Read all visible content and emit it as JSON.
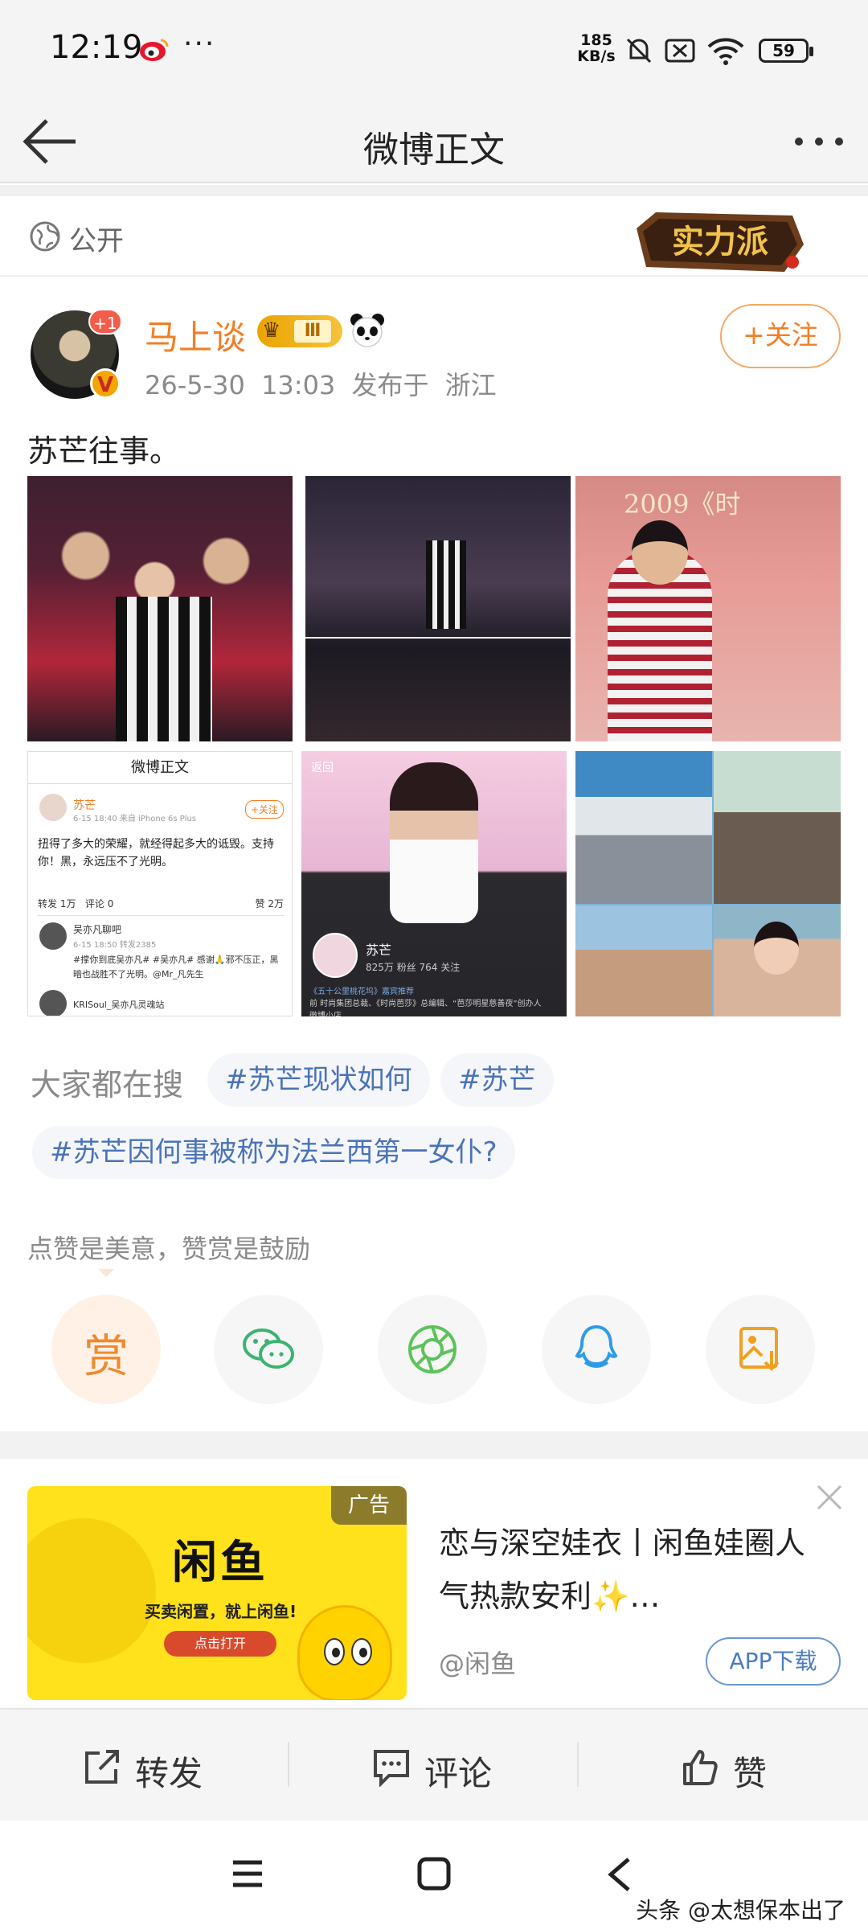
{
  "status_bar": {
    "time": "12:19",
    "more": "···",
    "network_speed_value": "185",
    "network_speed_unit": "KB/s",
    "battery": "59"
  },
  "header": {
    "title": "微博正文"
  },
  "visibility": {
    "label": "公开",
    "badge_text": "实力派"
  },
  "author": {
    "name": "马上谈",
    "notification_count": "+1",
    "level_badge": "Ⅲ",
    "verified_mark": "V",
    "timestamp": "26-5-30 13:03",
    "location": "发布于 浙江",
    "follow_label": "+关注"
  },
  "post": {
    "text": "苏芒往事。",
    "images": [
      {
        "icon": "photo-event-audience"
      },
      {
        "icon": "photo-event-collage"
      },
      {
        "icon": "photo-speech",
        "caption": "2009《时"
      },
      {
        "icon": "screenshot-weibo-post"
      },
      {
        "icon": "screenshot-weibo-profile"
      },
      {
        "icon": "photo-collage-dinner"
      }
    ],
    "embedded_post": {
      "title": "微博正文",
      "user": "苏芒",
      "meta": "6-15 18:40  来自 iPhone 6s Plus",
      "follow": "+关注",
      "body": "扭得了多大的荣耀，就经得起多大的诋毁。支持你！黑，永远压不了光明。",
      "tab_repost": "转发 1万",
      "tab_comment": "评论 0",
      "tab_like": "赞 2万",
      "commenter": "吴亦凡聊吧",
      "commenter_meta": "6-15 18:50    转发2385",
      "comment_text": "#撑你到底吴亦凡# #吴亦凡# 感谢🙏邪不压正，黑暗也战胜不了光明。@Mr_凡先生",
      "commenter2": "KRISoul_吴亦凡灵魂站"
    },
    "embedded_profile": {
      "back": "返回",
      "name": "苏芒",
      "stats": "825万 粉丝    764 关注",
      "tag": "《五十公里桃花坞》嘉宾推荐",
      "bio": "前 时尚集团总裁、《时尚芭莎》总编辑、“芭莎明星慈善夜”创办人",
      "shop": "微博小店"
    }
  },
  "trending": {
    "label": "大家都在搜",
    "tags": [
      "#苏芒现状如何",
      "#苏芒",
      "#苏芒因何事被称为法兰西第一女仆?"
    ]
  },
  "reward": {
    "hint": "点赞是美意，赞赏是鼓励",
    "reward_glyph": "赏",
    "share_targets": [
      "wechat-icon",
      "moments-icon",
      "qq-icon",
      "save-image-icon"
    ]
  },
  "ad": {
    "tag": "广告",
    "brand_logo": "闲鱼",
    "slogan": "买卖闲置，就上闲鱼!",
    "cta_image": "点击打开",
    "title": "恋与深空娃衣丨闲鱼娃圈人气热款安利✨…",
    "source": "@闲鱼",
    "download": "APP下载"
  },
  "actions": {
    "repost": "转发",
    "comment": "评论",
    "like": "赞"
  },
  "watermark": "头条 @太想保本出了",
  "colors": {
    "accent_orange": "#f27e24",
    "link_blue": "#4a73b8",
    "ad_yellow": "#ffe11c"
  }
}
